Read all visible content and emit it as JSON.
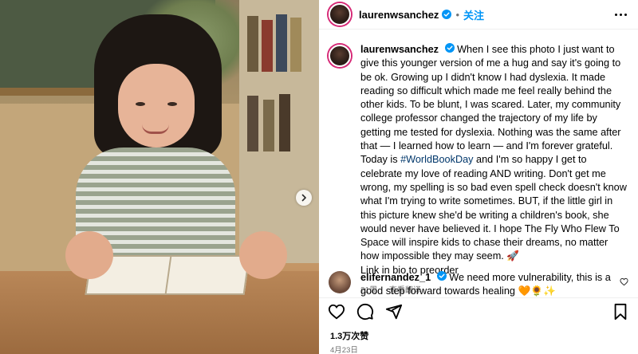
{
  "post": {
    "username": "laurenwsanchez",
    "follow_label": "关注",
    "separator": "•"
  },
  "caption": {
    "username": "laurenwsanchez",
    "text_before_tag": "When I see this photo I just want to give this younger version of me a hug and say it's going to be ok. Growing up I didn't know I had dyslexia. It made reading so difficult which made me feel really behind the other kids. To be blunt, I was scared. Later, my community college professor changed the trajectory of my life by getting me tested for dyslexia. Nothing was the same after that — I learned how to learn — and I'm forever grateful. Today is ",
    "hashtag": "#WorldBookDay",
    "text_after_tag": " and I'm so happy I get to celebrate my love of reading AND writing. Don't get me wrong, my spelling is so bad even spell check doesn't know what I'm trying to write sometimes. BUT, if the little girl in this picture knew she'd be writing a children's book, she would never have believed it. I hope The Fly Who Flew To Space will inspire kids to chase their dreams, no matter how impossible they may seem. 🚀",
    "link_line": "Link in bio to preorder",
    "time": "21周",
    "translate_label": "查看翻译"
  },
  "comment": {
    "username": "elifernandez_1",
    "text": "We need more vulnerability, this is a good step forward towards healing 🧡🌻✨"
  },
  "stats": {
    "likes": "1.3万次赞",
    "date": "4月23日"
  },
  "icons": {
    "verified": "verified-badge-icon",
    "more": "more-options-icon",
    "like": "heart-icon",
    "comment": "comment-bubble-icon",
    "share": "paper-plane-icon",
    "save": "bookmark-icon",
    "next": "chevron-right-icon"
  },
  "colors": {
    "accent": "#0095f6",
    "hashtag": "#00376b",
    "muted": "#737373",
    "story_ring": "#d62976"
  }
}
